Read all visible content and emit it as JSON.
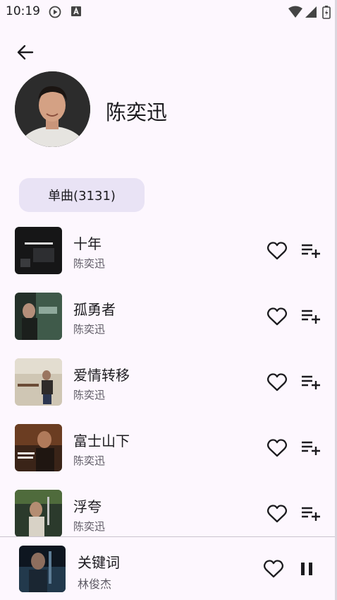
{
  "status_bar": {
    "time": "10:19",
    "icons": [
      "play-circle-icon",
      "a-badge-icon",
      "wifi-icon",
      "signal-icon",
      "battery-icon"
    ]
  },
  "header": {
    "back_icon": "arrow-left-icon",
    "artist_name": "陈奕迅"
  },
  "filter_chip": {
    "label": "单曲(3131)"
  },
  "songs": [
    {
      "title": "十年",
      "artist": "陈奕迅"
    },
    {
      "title": "孤勇者",
      "artist": "陈奕迅"
    },
    {
      "title": "爱情转移",
      "artist": "陈奕迅"
    },
    {
      "title": "富士山下",
      "artist": "陈奕迅"
    },
    {
      "title": "浮夸",
      "artist": "陈奕迅"
    }
  ],
  "player": {
    "title": "关键词",
    "artist": "林俊杰",
    "state": "playing"
  },
  "colors": {
    "background": "#fdf7fe",
    "chip": "#e9e3f5",
    "text": "#1c1b1f",
    "secondary_text": "#5f5b66"
  }
}
